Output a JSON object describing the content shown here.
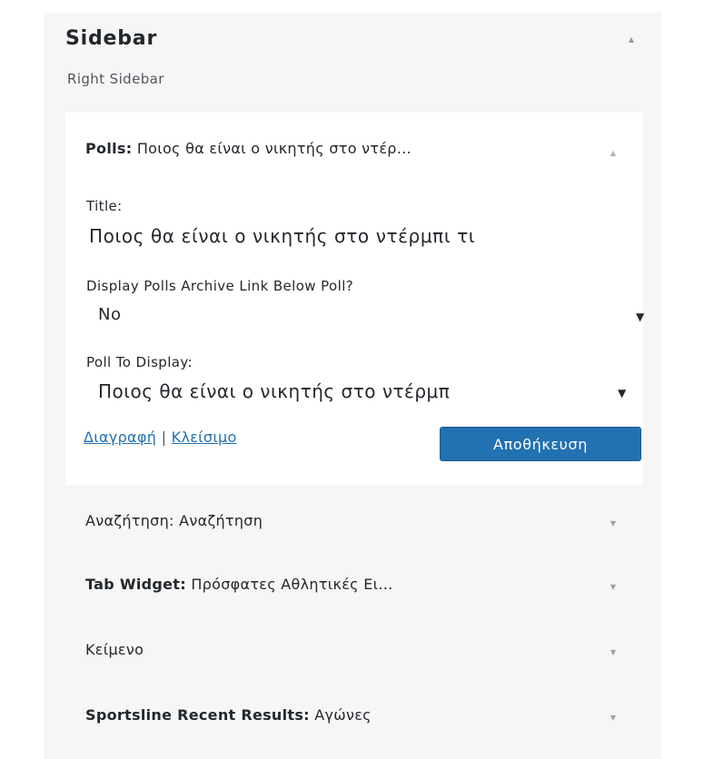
{
  "sidebar": {
    "title": "Sidebar",
    "description": "Right Sidebar",
    "toggle_icon": "caret-up-icon"
  },
  "open_widget": {
    "name": "Polls:",
    "subtitle": "Ποιος θα είναι ο νικητής στο ντέρ...",
    "title_label": "Title:",
    "title_value": "Ποιος θα είναι ο νικητής στο ντέρμπι τι",
    "archive_label": "Display Polls Archive Link Below Poll?",
    "archive_value": "No",
    "poll_label": "Poll To Display:",
    "poll_value": "Ποιος θα είναι ο νικητής στο ντέρμπ",
    "delete_link": "Διαγραφή",
    "separator": "|",
    "close_link": "Κλείσιμο",
    "save_button": "Αποθήκευση"
  },
  "widgets": [
    {
      "name": "Αναζήτηση:",
      "subtitle": "Αναζήτηση",
      "name_bold": false
    },
    {
      "name": "Tab Widget:",
      "subtitle": "Πρόσφατες Αθλητικές Ει...",
      "name_bold": true
    },
    {
      "name": "Κείμενο",
      "subtitle": "",
      "name_bold": false
    },
    {
      "name": "Sportsline Recent Results:",
      "subtitle": "Αγώνες",
      "name_bold": true
    }
  ],
  "colors": {
    "accent": "#2271b1",
    "panel_bg": "#f6f6f6"
  }
}
